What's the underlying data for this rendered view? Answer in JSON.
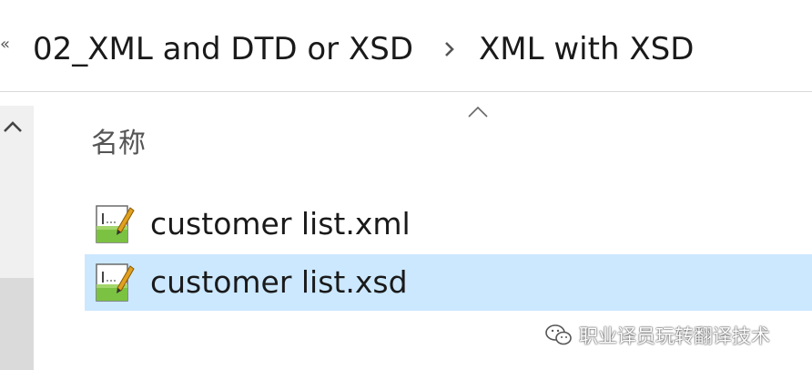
{
  "address_bar": {
    "overflow_icon": "double-chevron-left-icon",
    "breadcrumbs": [
      {
        "label": "02_XML and DTD or XSD"
      },
      {
        "label": "XML with XSD"
      }
    ],
    "separator_icon": "chevron-right-icon"
  },
  "file_list": {
    "sort_indicator_icon": "sort-up-icon",
    "column_header": "名称",
    "items": [
      {
        "name": "customer list.xml",
        "icon": "notepadpp-file-icon",
        "selected": false
      },
      {
        "name": "customer list.xsd",
        "icon": "notepadpp-file-icon",
        "selected": true
      }
    ]
  },
  "nav_pane": {
    "scroll_up_icon": "chevron-up-icon"
  },
  "watermark": {
    "text": "职业译员玩转翻译技术",
    "icon": "wechat-icon"
  },
  "colors": {
    "selection": "#cce8ff",
    "scrollbar_track": "#f0f0f0",
    "scrollbar_thumb": "#dadada"
  }
}
